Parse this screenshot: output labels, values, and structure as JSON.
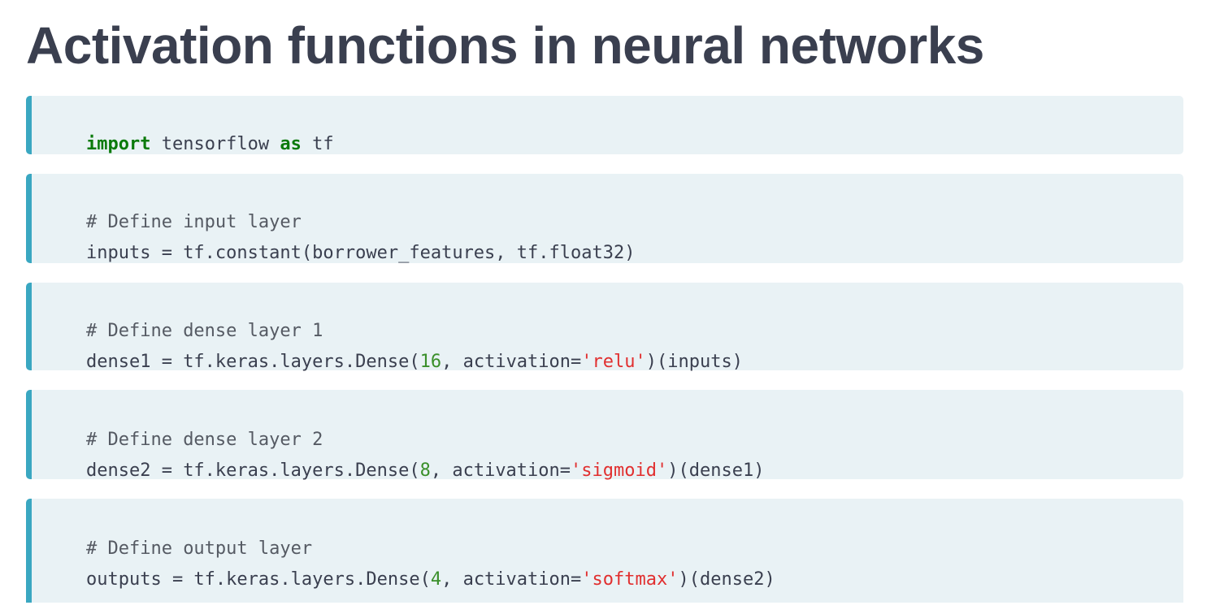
{
  "page": {
    "title": "Activation functions in neural networks"
  },
  "code_blocks": [
    {
      "lines": [
        {
          "tokens": [
            {
              "type": "kw",
              "text": "import"
            },
            {
              "type": "plain",
              "text": " tensorflow "
            },
            {
              "type": "kw",
              "text": "as"
            },
            {
              "type": "plain",
              "text": " tf"
            }
          ]
        }
      ]
    },
    {
      "lines": [
        {
          "tokens": [
            {
              "type": "cm",
              "text": "# Define input layer"
            }
          ]
        },
        {
          "tokens": [
            {
              "type": "plain",
              "text": "inputs = tf.constant(borrower_features, tf.float32)"
            }
          ]
        }
      ]
    },
    {
      "lines": [
        {
          "tokens": [
            {
              "type": "cm",
              "text": "# Define dense layer 1"
            }
          ]
        },
        {
          "tokens": [
            {
              "type": "plain",
              "text": "dense1 = tf.keras.layers.Dense("
            },
            {
              "type": "num",
              "text": "16"
            },
            {
              "type": "plain",
              "text": ", activation="
            },
            {
              "type": "str",
              "text": "'relu'"
            },
            {
              "type": "plain",
              "text": ")(inputs)"
            }
          ]
        }
      ]
    },
    {
      "lines": [
        {
          "tokens": [
            {
              "type": "cm",
              "text": "# Define dense layer 2"
            }
          ]
        },
        {
          "tokens": [
            {
              "type": "plain",
              "text": "dense2 = tf.keras.layers.Dense("
            },
            {
              "type": "num",
              "text": "8"
            },
            {
              "type": "plain",
              "text": ", activation="
            },
            {
              "type": "str",
              "text": "'sigmoid'"
            },
            {
              "type": "plain",
              "text": ")(dense1)"
            }
          ]
        }
      ]
    },
    {
      "lines": [
        {
          "tokens": [
            {
              "type": "cm",
              "text": "# Define output layer"
            }
          ]
        },
        {
          "tokens": [
            {
              "type": "plain",
              "text": "outputs = tf.keras.layers.Dense("
            },
            {
              "type": "num",
              "text": "4"
            },
            {
              "type": "plain",
              "text": ", activation="
            },
            {
              "type": "str",
              "text": "'softmax'"
            },
            {
              "type": "plain",
              "text": ")(dense2)"
            }
          ]
        }
      ]
    }
  ],
  "colors": {
    "title": "#3a3f4f",
    "block_background": "#e9f2f5",
    "block_accent": "#3aa7c1",
    "keyword": "#0b7a0b",
    "comment": "#555a63",
    "number": "#3a8f2a",
    "string": "#e12f2f"
  }
}
